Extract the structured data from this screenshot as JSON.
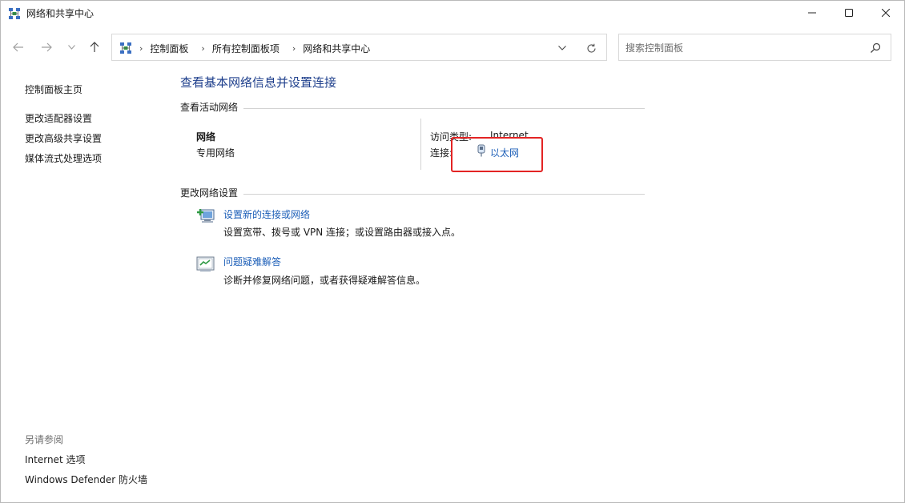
{
  "window": {
    "title": "网络和共享中心",
    "icon": "network-center-icon"
  },
  "titlebar_buttons": {
    "minimize_icon": "minimize-icon",
    "maximize_icon": "maximize-icon",
    "close_icon": "close-icon"
  },
  "nav": {
    "back_icon": "arrow-left-icon",
    "forward_icon": "arrow-right-icon",
    "recent_icon": "chevron-down-icon",
    "up_icon": "arrow-up-icon"
  },
  "address": {
    "crumbs": [
      "控制面板",
      "所有控制面板项",
      "网络和共享中心"
    ],
    "separator": "›"
  },
  "search": {
    "placeholder": "搜索控制面板"
  },
  "left_panel": {
    "home": "控制面板主页",
    "links": [
      "更改适配器设置",
      "更改高级共享设置",
      "媒体流式处理选项"
    ],
    "see_also_heading": "另请参阅",
    "see_also": [
      "Internet 选项",
      "Windows Defender 防火墙"
    ]
  },
  "main": {
    "title": "查看基本网络信息并设置连接",
    "active_heading": "查看活动网络",
    "network": {
      "name": "网络",
      "profile": "专用网络",
      "access_label": "访问类型:",
      "access_value": "Internet",
      "connection_label": "连接:",
      "connection_value": "以太网"
    },
    "change_heading": "更改网络设置",
    "tasks": [
      {
        "icon": "new-connection-icon",
        "link": "设置新的连接或网络",
        "desc": "设置宽带、拨号或 VPN 连接；或设置路由器或接入点。"
      },
      {
        "icon": "troubleshoot-icon",
        "link": "问题疑难解答",
        "desc": "诊断并修复网络问题，或者获得疑难解答信息。"
      }
    ]
  },
  "colors": {
    "link": "#1d5fb8",
    "title": "#1e3f8c",
    "highlight": "#e32424"
  }
}
